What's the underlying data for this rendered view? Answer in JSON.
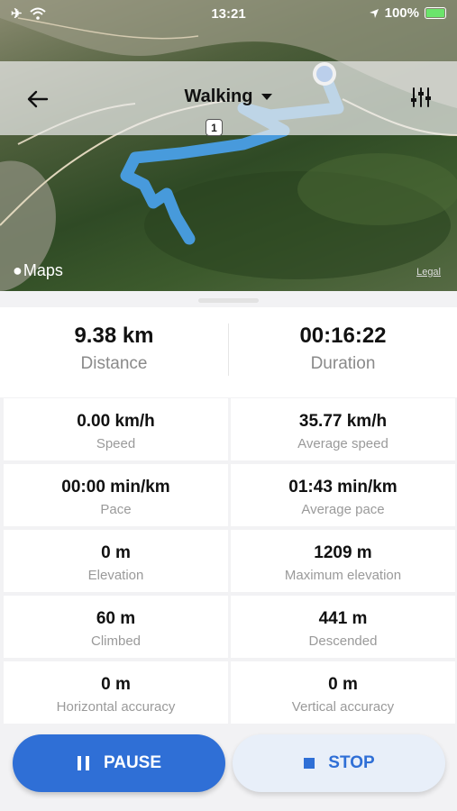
{
  "status_bar": {
    "time": "13:21",
    "battery": "100%"
  },
  "header": {
    "activity": "Walking",
    "lane_badge": "1"
  },
  "map": {
    "attribution": "Maps",
    "legal": "Legal"
  },
  "summary": {
    "distance": {
      "value": "9.38 km",
      "label": "Distance"
    },
    "duration": {
      "value": "00:16:22",
      "label": "Duration"
    }
  },
  "stats": [
    {
      "value": "0.00 km/h",
      "label": "Speed"
    },
    {
      "value": "35.77 km/h",
      "label": "Average speed"
    },
    {
      "value": "00:00 min/km",
      "label": "Pace"
    },
    {
      "value": "01:43 min/km",
      "label": "Average pace"
    },
    {
      "value": "0 m",
      "label": "Elevation"
    },
    {
      "value": "1209 m",
      "label": "Maximum elevation"
    },
    {
      "value": "60 m",
      "label": "Climbed"
    },
    {
      "value": "441 m",
      "label": "Descended"
    },
    {
      "value": "0 m",
      "label": "Horizontal accuracy"
    },
    {
      "value": "0 m",
      "label": "Vertical accuracy"
    }
  ],
  "actions": {
    "pause": "PAUSE",
    "stop": "STOP"
  },
  "colors": {
    "accent": "#2f6fd6",
    "route": "#4aa3f0"
  }
}
